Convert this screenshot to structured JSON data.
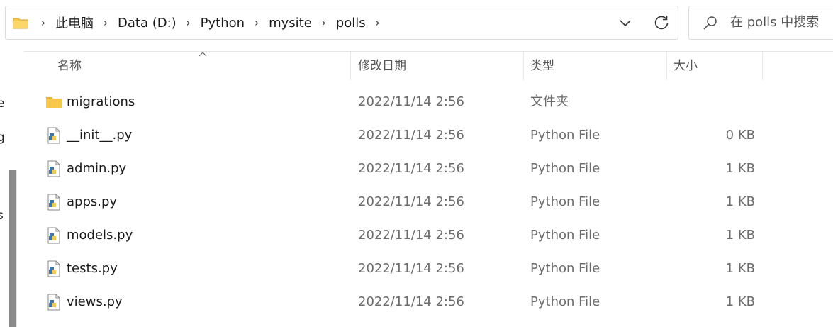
{
  "address_bar": {
    "folder_icon": "folder-icon",
    "crumbs": [
      "此电脑",
      "Data (D:)",
      "Python",
      "mysite",
      "polls"
    ],
    "dropdown_icon": "chevron-down-icon",
    "refresh_icon": "refresh-icon"
  },
  "search": {
    "icon": "search-icon",
    "placeholder": "在 polls 中搜索"
  },
  "nav_pane": {
    "fragments": [
      "e",
      "g",
      "s"
    ]
  },
  "columns": {
    "name": "名称",
    "date": "修改日期",
    "type": "类型",
    "size": "大小"
  },
  "files": [
    {
      "name": "migrations",
      "date": "2022/11/14 2:56",
      "type": "文件夹",
      "size": "",
      "icon": "folder-icon"
    },
    {
      "name": "__init__.py",
      "date": "2022/11/14 2:56",
      "type": "Python File",
      "size": "0 KB",
      "icon": "python-file-icon"
    },
    {
      "name": "admin.py",
      "date": "2022/11/14 2:56",
      "type": "Python File",
      "size": "1 KB",
      "icon": "python-file-icon"
    },
    {
      "name": "apps.py",
      "date": "2022/11/14 2:56",
      "type": "Python File",
      "size": "1 KB",
      "icon": "python-file-icon"
    },
    {
      "name": "models.py",
      "date": "2022/11/14 2:56",
      "type": "Python File",
      "size": "1 KB",
      "icon": "python-file-icon"
    },
    {
      "name": "tests.py",
      "date": "2022/11/14 2:56",
      "type": "Python File",
      "size": "1 KB",
      "icon": "python-file-icon"
    },
    {
      "name": "views.py",
      "date": "2022/11/14 2:56",
      "type": "Python File",
      "size": "1 KB",
      "icon": "python-file-icon"
    }
  ],
  "colors": {
    "folder": "#F8C84A",
    "python_blue": "#3B77A8",
    "python_yellow": "#F2C94C"
  }
}
